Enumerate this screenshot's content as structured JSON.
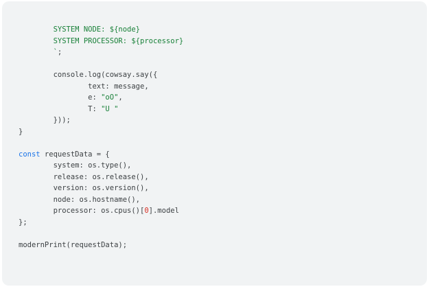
{
  "code": {
    "language": "javascript",
    "colors": {
      "background": "#f1f3f4",
      "text": "#3c4043",
      "string": "#188038",
      "keyword": "#1a73e8",
      "number": "#d93025"
    },
    "lines": [
      [
        {
          "t": "str",
          "v": "        SYSTEM NODE: ${node}"
        }
      ],
      [
        {
          "t": "str",
          "v": "        SYSTEM PROCESSOR: ${processor}"
        }
      ],
      [
        {
          "t": "str",
          "v": "        `"
        },
        {
          "t": "plain",
          "v": ";"
        }
      ],
      [],
      [
        {
          "t": "plain",
          "v": "        console.log(cowsay.say({"
        }
      ],
      [
        {
          "t": "plain",
          "v": "                text: message,"
        }
      ],
      [
        {
          "t": "plain",
          "v": "                e: "
        },
        {
          "t": "str",
          "v": "\"oO\""
        },
        {
          "t": "plain",
          "v": ","
        }
      ],
      [
        {
          "t": "plain",
          "v": "                T: "
        },
        {
          "t": "str",
          "v": "\"U \""
        }
      ],
      [
        {
          "t": "plain",
          "v": "        }));"
        }
      ],
      [
        {
          "t": "plain",
          "v": "}"
        }
      ],
      [],
      [
        {
          "t": "kw",
          "v": "const"
        },
        {
          "t": "plain",
          "v": " requestData = {"
        }
      ],
      [
        {
          "t": "plain",
          "v": "        system: os.type(),"
        }
      ],
      [
        {
          "t": "plain",
          "v": "        release: os.release(),"
        }
      ],
      [
        {
          "t": "plain",
          "v": "        version: os.version(),"
        }
      ],
      [
        {
          "t": "plain",
          "v": "        node: os.hostname(),"
        }
      ],
      [
        {
          "t": "plain",
          "v": "        processor: os.cpus()["
        },
        {
          "t": "num",
          "v": "0"
        },
        {
          "t": "plain",
          "v": "].model"
        }
      ],
      [
        {
          "t": "plain",
          "v": "};"
        }
      ],
      [],
      [
        {
          "t": "plain",
          "v": "modernPrint(requestData);"
        }
      ]
    ]
  }
}
